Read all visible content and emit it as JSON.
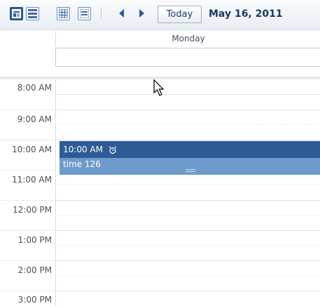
{
  "toolbar": {
    "views": [
      {
        "icon": "day-view-icon",
        "active": true
      },
      {
        "icon": "week-view-icon",
        "active": false
      },
      {
        "icon": "month-view-icon",
        "active": false
      },
      {
        "icon": "list-view-icon",
        "active": false
      }
    ],
    "prev_icon": "previous-arrow-icon",
    "next_icon": "next-arrow-icon",
    "today_label": "Today",
    "date_label": "May 16, 2011"
  },
  "day": {
    "header": "Monday"
  },
  "hours": [
    "8:00 AM",
    "9:00 AM",
    "10:00 AM",
    "11:00 AM",
    "12:00 PM",
    "1:00 PM",
    "2:00 PM",
    "3:00 PM"
  ],
  "event": {
    "time": "10:00 AM",
    "title": "time 126",
    "icon": "alarm-icon"
  },
  "colors": {
    "accent": "#2d5b95",
    "event_body": "#6f9bcc"
  }
}
